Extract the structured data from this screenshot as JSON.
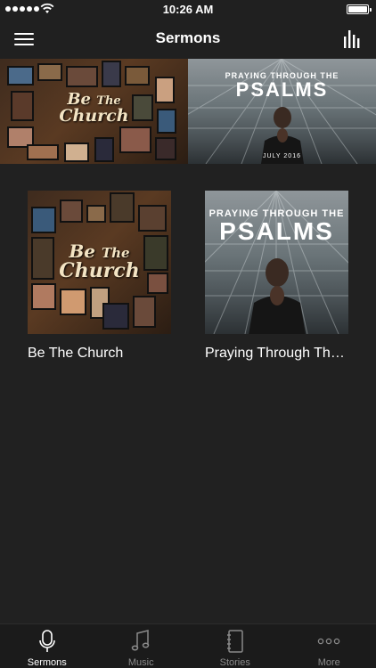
{
  "status": {
    "time": "10:26 AM",
    "battery_level": 1.0
  },
  "nav": {
    "title": "Sermons"
  },
  "hero": [
    {
      "id": "be-the-church",
      "line1": "Be",
      "line2": "The",
      "line3": "Church"
    },
    {
      "id": "psalms",
      "top_line": "PRAYING THROUGH THE",
      "big_line": "PSALMS",
      "date": "JULY 2016"
    }
  ],
  "series": [
    {
      "title": "Be The Church",
      "art": {
        "line1": "Be",
        "line2": "The",
        "line3": "Church"
      }
    },
    {
      "title": "Praying Through The...",
      "art": {
        "top_line": "PRAYING THROUGH THE",
        "big_line": "PSALMS"
      }
    }
  ],
  "tabs": [
    {
      "label": "Sermons",
      "icon": "microphone-icon",
      "active": true
    },
    {
      "label": "Music",
      "icon": "music-note-icon",
      "active": false
    },
    {
      "label": "Stories",
      "icon": "notebook-icon",
      "active": false
    },
    {
      "label": "More",
      "icon": "more-dots-icon",
      "active": false
    }
  ],
  "colors": {
    "background": "#212121",
    "bar": "#202020",
    "tab_bar": "#1b1b1b",
    "inactive_tab": "#8a8a8a"
  }
}
